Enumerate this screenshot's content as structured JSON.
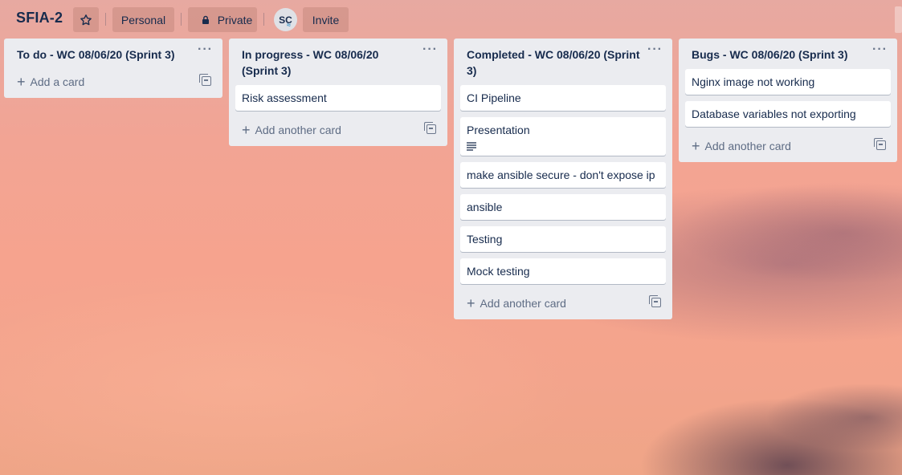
{
  "board": {
    "title": "SFIA-2",
    "star_icon": "star-icon",
    "personal_label": "Personal",
    "private_label": "Private",
    "invite_label": "Invite",
    "avatar_initials": "SC"
  },
  "lists": [
    {
      "title": "To do - WC 08/06/20 (Sprint 3)",
      "cards": [],
      "add_label": "Add a card"
    },
    {
      "title": "In progress - WC 08/06/20 (Sprint 3)",
      "cards": [
        {
          "title": "Risk assessment"
        }
      ],
      "add_label": "Add another card"
    },
    {
      "title": "Completed - WC 08/06/20 (Sprint 3)",
      "cards": [
        {
          "title": "CI Pipeline"
        },
        {
          "title": "Presentation",
          "has_description": true
        },
        {
          "title": "make ansible secure - don't expose ip"
        },
        {
          "title": "ansible"
        },
        {
          "title": "Testing"
        },
        {
          "title": "Mock testing"
        }
      ],
      "add_label": "Add another card"
    },
    {
      "title": "Bugs - WC 08/06/20 (Sprint 3)",
      "cards": [
        {
          "title": "Nginx image not working"
        },
        {
          "title": "Database variables not exporting"
        }
      ],
      "add_label": "Add another card"
    }
  ]
}
